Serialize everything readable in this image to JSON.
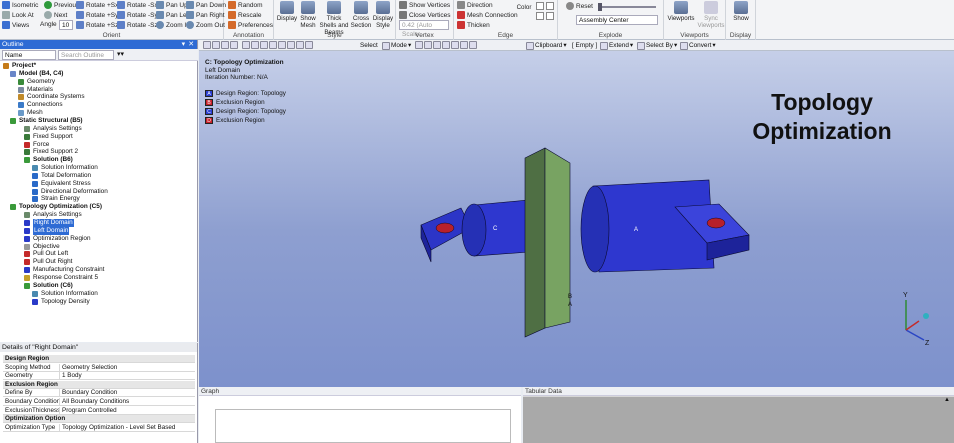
{
  "ribbon": {
    "orient": {
      "label": "Orient",
      "isometric": "Isometric",
      "previous": "Previous",
      "rotate_px": "Rotate +Sx",
      "rotate_nx": "Rotate -Sx",
      "pan_up": "Pan Up",
      "pan_down": "Pan Down",
      "look_at": "Look At",
      "next": "Next",
      "rotate_py": "Rotate +Sy",
      "rotate_ny": "Rotate -Sy",
      "pan_left": "Pan Left",
      "pan_right": "Pan Right",
      "views": "Views",
      "angle_label": "Angle",
      "angle_value": "10",
      "rotate_pz": "Rotate +Sz",
      "rotate_nz": "Rotate -Sz",
      "zoom_in": "Zoom In",
      "zoom_out": "Zoom Out"
    },
    "annotation": {
      "label": "Annotation",
      "random": "Random",
      "rescale": "Rescale",
      "preferences": "Preferences"
    },
    "style": {
      "label": "Style",
      "display": "Display",
      "show_mesh": "Show Mesh",
      "thick_shells": "Thick Shells and Beams",
      "cross_section": "Cross Section",
      "display_style": "Display Style"
    },
    "vertex": {
      "label": "Vertex",
      "show_vertices": "Show Vertices",
      "close_vertices": "Close Vertices",
      "auto_scale": "0.42 (Auto Scale"
    },
    "edge": {
      "label": "Edge",
      "direction": "Direction",
      "mesh_connection": "Mesh Connection",
      "thicken": "Thicken",
      "color": "Color"
    },
    "explode": {
      "label": "Explode",
      "reset": "Reset",
      "assembly_center": "Assembly Center"
    },
    "viewports": {
      "label": "Viewports",
      "viewports": "Viewports",
      "sync": "Sync Viewports"
    },
    "display_group": {
      "label": "Display",
      "show": "Show"
    }
  },
  "outline": {
    "title": "Outline",
    "name_dropdown": "Name",
    "search_placeholder": "Search Outline",
    "tree": [
      {
        "label": "Project*",
        "bold": true
      },
      {
        "label": "Model (B4, C4)",
        "bold": true
      },
      {
        "label": "Geometry"
      },
      {
        "label": "Materials"
      },
      {
        "label": "Coordinate Systems"
      },
      {
        "label": "Connections"
      },
      {
        "label": "Mesh"
      },
      {
        "label": "Static Structural (B5)",
        "bold": true
      },
      {
        "label": "Analysis Settings"
      },
      {
        "label": "Fixed Support"
      },
      {
        "label": "Force"
      },
      {
        "label": "Fixed Support 2"
      },
      {
        "label": "Solution (B6)",
        "bold": true
      },
      {
        "label": "Solution Information"
      },
      {
        "label": "Total Deformation"
      },
      {
        "label": "Equivalent Stress"
      },
      {
        "label": "Directional Deformation"
      },
      {
        "label": "Strain Energy"
      },
      {
        "label": "Topology Optimization (C5)",
        "bold": true
      },
      {
        "label": "Analysis Settings"
      },
      {
        "label": "Right Domain"
      },
      {
        "label": "Left Domain"
      },
      {
        "label": "Optimization Region"
      },
      {
        "label": "Objective"
      },
      {
        "label": "Pull Out Left"
      },
      {
        "label": "Pull Out Right"
      },
      {
        "label": "Manufacturing Constraint"
      },
      {
        "label": "Response Constraint 5"
      },
      {
        "label": "Solution (C6)",
        "bold": true
      },
      {
        "label": "Solution Information"
      },
      {
        "label": "Topology Density"
      }
    ]
  },
  "details": {
    "title": "Details of \"Right Domain\"",
    "rows": [
      {
        "section": "Design Region"
      },
      {
        "key": "Scoping Method",
        "value": "Geometry Selection"
      },
      {
        "key": "Geometry",
        "value": "1 Body"
      },
      {
        "section": "Exclusion Region"
      },
      {
        "key": "Define By",
        "value": "Boundary Condition"
      },
      {
        "key": "Boundary Condition",
        "value": "All Boundary Conditions"
      },
      {
        "key": "ExclusionThickness",
        "value": "Program Controlled"
      },
      {
        "section": "Optimization Option"
      },
      {
        "key": "Optimization Type",
        "value": "Topology Optimization - Level Set Based"
      }
    ]
  },
  "graphics_toolbar": {
    "select": "Select",
    "mode": "Mode",
    "clipboard": "Clipboard",
    "empty": "[ Empty ]",
    "extend": "Extend",
    "select_by": "Select By",
    "convert": "Convert"
  },
  "viewport": {
    "header_title": "C: Topology Optimization",
    "header_sub1": "Left Domain",
    "header_sub2": "Iteration Number: N/A",
    "legend": [
      {
        "tag": "A",
        "label": "Design Region: Topology",
        "color": "#2b3fd2"
      },
      {
        "tag": "B",
        "label": "Exclusion Region",
        "color": "#c8202a"
      },
      {
        "tag": "C",
        "label": "Design Region: Topology",
        "color": "#2b3fd2"
      },
      {
        "tag": "D",
        "label": "Exclusion Region",
        "color": "#c8202a"
      }
    ],
    "overlay_line1": "Topology",
    "overlay_line2": "Optimization",
    "axis_y": "Y",
    "axis_z": "Z"
  },
  "graph": {
    "title": "Graph"
  },
  "tabular": {
    "title": "Tabular Data"
  }
}
